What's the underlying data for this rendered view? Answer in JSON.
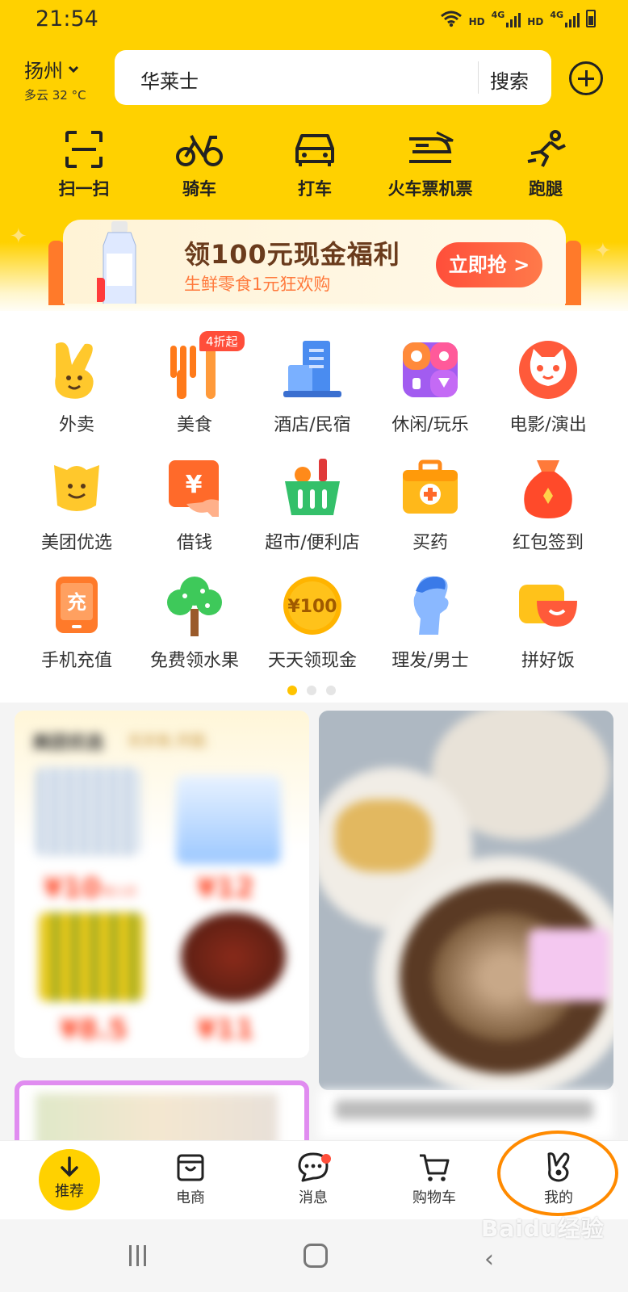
{
  "status_bar": {
    "time": "21:54",
    "hd1": "HD",
    "net1": "4G",
    "hd2": "HD",
    "net2": "4G"
  },
  "location": {
    "city": "扬州",
    "weather": "多云 32 °C"
  },
  "search": {
    "query": "华莱士",
    "button": "搜索"
  },
  "quick_actions": [
    {
      "label": "扫一扫",
      "icon": "scan-icon"
    },
    {
      "label": "骑车",
      "icon": "bike-icon"
    },
    {
      "label": "打车",
      "icon": "car-icon"
    },
    {
      "label": "火车票机票",
      "icon": "train-plane-icon"
    },
    {
      "label": "跑腿",
      "icon": "runner-icon"
    }
  ],
  "promo": {
    "title": "领100元现金福利",
    "subtitle": "生鲜零食1元狂欢购",
    "button": "立即抢 >"
  },
  "categories": [
    {
      "label": "外卖",
      "icon": "takeout-icon"
    },
    {
      "label": "美食",
      "icon": "food-icon",
      "badge": "4折起"
    },
    {
      "label": "酒店/民宿",
      "icon": "hotel-icon"
    },
    {
      "label": "休闲/玩乐",
      "icon": "leisure-icon"
    },
    {
      "label": "电影/演出",
      "icon": "movie-icon"
    },
    {
      "label": "美团优选",
      "icon": "youxuan-icon"
    },
    {
      "label": "借钱",
      "icon": "loan-icon",
      "icon_text": "¥"
    },
    {
      "label": "超市/便利店",
      "icon": "supermarket-icon"
    },
    {
      "label": "买药",
      "icon": "medicine-icon"
    },
    {
      "label": "红包签到",
      "icon": "red-packet-icon"
    },
    {
      "label": "手机充值",
      "icon": "phone-recharge-icon",
      "icon_text": "充"
    },
    {
      "label": "免费领水果",
      "icon": "fruit-tree-icon"
    },
    {
      "label": "天天领现金",
      "icon": "cash-coin-icon",
      "icon_text": "¥100"
    },
    {
      "label": "理发/男士",
      "icon": "haircut-icon"
    },
    {
      "label": "拼好饭",
      "icon": "pinhaofan-icon"
    }
  ],
  "pager": {
    "pages": 3,
    "active": 0
  },
  "feed": {
    "card1": {
      "title": "美团优选",
      "subtitle": "天天有.开团.",
      "prices": [
        "¥10",
        "¥12",
        "¥8.5",
        "¥11"
      ],
      "price_note": "新人价"
    }
  },
  "tab_bar": [
    {
      "label": "推荐",
      "icon": "arrow-down-icon",
      "active": true
    },
    {
      "label": "电商",
      "icon": "shop-bag-icon"
    },
    {
      "label": "消息",
      "icon": "chat-icon",
      "unread_dot": true
    },
    {
      "label": "购物车",
      "icon": "cart-icon"
    },
    {
      "label": "我的",
      "icon": "rabbit-icon",
      "highlighted": true
    }
  ],
  "watermark": "Baidu经验",
  "colors": {
    "brand_yellow": "#ffd100",
    "accent_red": "#ff4e3a",
    "highlight_orange": "#ff8a00"
  }
}
